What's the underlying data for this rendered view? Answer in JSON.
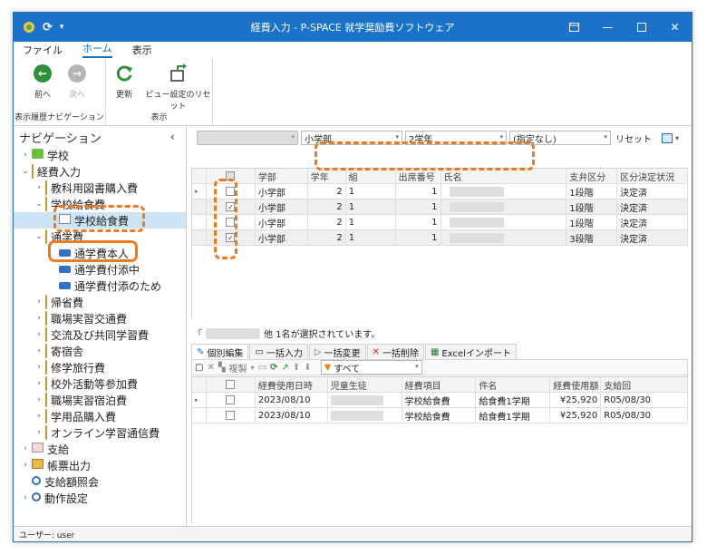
{
  "window": {
    "title": "経費入力 - P-SPACE 就学奨励費ソフトウェア",
    "accent": "#1a73c8",
    "highlight_color": "#ea7b21"
  },
  "menu": [
    "ファイル",
    "ホーム",
    "表示"
  ],
  "ribbon": {
    "groups": [
      {
        "label": "表示履歴ナビゲーション",
        "buttons": [
          "前へ",
          "次へ"
        ]
      },
      {
        "label": "表示",
        "buttons": [
          "更新",
          "ビュー設定のリセット"
        ]
      }
    ]
  },
  "nav": {
    "title": "ナビゲーション",
    "collapse_icon": "‹",
    "items": [
      {
        "label": "学校",
        "level": 0,
        "icon": "school-icon",
        "expander": "›"
      },
      {
        "label": "経費入力",
        "level": 0,
        "icon": "folder-icon",
        "expander": "⌄"
      },
      {
        "label": "教科用図書購入費",
        "level": 1,
        "icon": "folder-icon",
        "expander": "›"
      },
      {
        "label": "学校給食費",
        "level": 1,
        "icon": "folder-icon",
        "expander": "⌄"
      },
      {
        "label": "学校給食費",
        "level": 2,
        "icon": "lunch-icon",
        "selected": true
      },
      {
        "label": "通学費",
        "level": 1,
        "icon": "folder-icon",
        "expander": "⌄"
      },
      {
        "label": "通学費本人",
        "level": 2,
        "icon": "bus-icon"
      },
      {
        "label": "通学費付添中",
        "level": 2,
        "icon": "bus-icon"
      },
      {
        "label": "通学費付添のため",
        "level": 2,
        "icon": "bus-icon"
      },
      {
        "label": "帰省費",
        "level": 1,
        "icon": "folder-icon",
        "expander": "›"
      },
      {
        "label": "職場実習交通費",
        "level": 1,
        "icon": "folder-icon",
        "expander": "›"
      },
      {
        "label": "交流及び共同学習費",
        "level": 1,
        "icon": "folder-icon",
        "expander": "›"
      },
      {
        "label": "寄宿舎",
        "level": 1,
        "icon": "folder-icon",
        "expander": "›"
      },
      {
        "label": "修学旅行費",
        "level": 1,
        "icon": "folder-icon",
        "expander": "›"
      },
      {
        "label": "校外活動等参加費",
        "level": 1,
        "icon": "folder-icon",
        "expander": "›"
      },
      {
        "label": "職場実習宿泊費",
        "level": 1,
        "icon": "folder-icon",
        "expander": "›"
      },
      {
        "label": "学用品購入費",
        "level": 1,
        "icon": "folder-icon",
        "expander": "›"
      },
      {
        "label": "オンライン学習通信費",
        "level": 1,
        "icon": "folder-icon",
        "expander": "›"
      },
      {
        "label": "支給",
        "level": 0,
        "icon": "payment-icon",
        "expander": "›"
      },
      {
        "label": "帳票出力",
        "level": 0,
        "icon": "report-icon",
        "expander": "›"
      },
      {
        "label": "支給額照会",
        "level": 0,
        "icon": "search-icon",
        "expander": ""
      },
      {
        "label": "動作設定",
        "level": 0,
        "icon": "gear-icon",
        "expander": "›"
      }
    ]
  },
  "filter": {
    "department": "小学部",
    "grade": "2学年",
    "other": "(指定なし)",
    "reset_label": "リセット"
  },
  "students_grid": {
    "columns": [
      "",
      "学部",
      "学年",
      "組",
      "出席番号",
      "氏名",
      "支弁区分",
      "区分決定状況"
    ],
    "rows": [
      {
        "checked": false,
        "dept": "小学部",
        "grade": "2",
        "cls": "1",
        "num": "1",
        "level": "1段階",
        "status": "決定済"
      },
      {
        "checked": true,
        "dept": "小学部",
        "grade": "2",
        "cls": "1",
        "num": "1",
        "level": "1段階",
        "status": "決定済"
      },
      {
        "checked": false,
        "dept": "小学部",
        "grade": "2",
        "cls": "1",
        "num": "1",
        "level": "1段階",
        "status": "決定済"
      },
      {
        "checked": true,
        "dept": "小学部",
        "grade": "2",
        "cls": "1",
        "num": "1",
        "level": "3段階",
        "status": "決定済"
      }
    ]
  },
  "selection_note": "他 1名が選択されています。",
  "detail_tabs": [
    "個別編集",
    "一括入力",
    "一括変更",
    "一括削除",
    "Excelインポート"
  ],
  "detail_toolbar": {
    "copy_label": "複製",
    "filter_value": "すべて"
  },
  "expense_grid": {
    "columns": [
      "",
      "経費使用日時",
      "児童生徒",
      "経費項目",
      "件名",
      "経費使用額",
      "支給回"
    ],
    "rows": [
      {
        "date": "2023/08/10",
        "item": "学校給食費",
        "subject": "給食費1学期",
        "amount": "¥25,920",
        "round": "R05/08/30"
      },
      {
        "date": "2023/08/10",
        "item": "学校給食費",
        "subject": "給食費1学期",
        "amount": "¥25,920",
        "round": "R05/08/30"
      }
    ]
  },
  "status": {
    "user": "ユーザー: user"
  }
}
